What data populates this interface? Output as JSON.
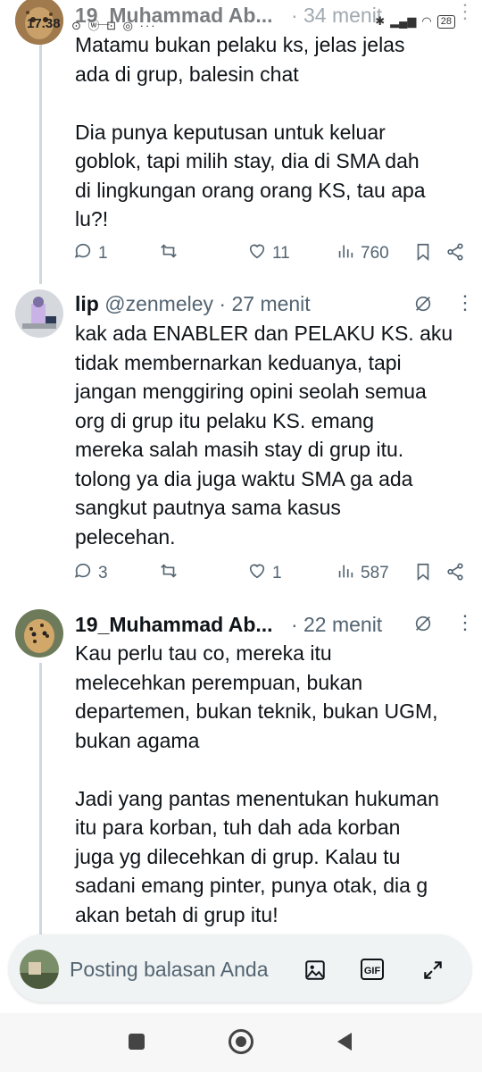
{
  "status_bar": {
    "time": "17.38",
    "left_icons": "⊙ ⓦ ⊡ ◎ ···",
    "battery": "28"
  },
  "tweets": [
    {
      "name": "19_Muhammad Ab...",
      "handle": "",
      "time": "· 34 menit",
      "lines": [
        "Matamu bukan pelaku ks, jelas jelas",
        "ada di grup, balesin chat",
        "",
        "Dia punya keputusan untuk keluar",
        "goblok, tapi milih stay, dia di SMA dah",
        "di lingkungan orang orang KS, tau apa",
        "lu?!"
      ],
      "replies": "1",
      "retweets": "",
      "likes": "11",
      "views": "760"
    },
    {
      "name": "lip",
      "handle": "@zenmeley",
      "time": "· 27 menit",
      "lines": [
        "kak ada ENABLER dan PELAKU KS. aku",
        "tidak membernarkan keduanya, tapi",
        "jangan menggiring opini seolah semua",
        "org di grup itu pelaku KS. emang",
        "mereka salah masih stay di grup itu.",
        "tolong ya dia juga waktu SMA ga ada",
        "sangkut pautnya sama kasus",
        "pelecehan."
      ],
      "replies": "3",
      "retweets": "",
      "likes": "1",
      "views": "587"
    },
    {
      "name": "19_Muhammad Ab...",
      "handle": "",
      "time": "· 22 menit",
      "lines": [
        "Kau perlu tau co, mereka itu",
        "melecehkan perempuan, bukan",
        "departemen, bukan teknik, bukan UGM,",
        "bukan agama",
        "",
        "Jadi yang pantas menentukan hukuman",
        "itu para korban, tuh dah ada korban",
        "juga yg dilecehkan di grup. Kalau tu",
        "sadani emang pinter, punya otak, dia g",
        "akan betah di grup itu!"
      ]
    }
  ],
  "reply_bar": {
    "placeholder": "Posting balasan Anda",
    "gif_label": "GIF"
  },
  "colors": {
    "text": "#0f1419",
    "muted": "#536471",
    "thread_line": "#cfd9de"
  }
}
